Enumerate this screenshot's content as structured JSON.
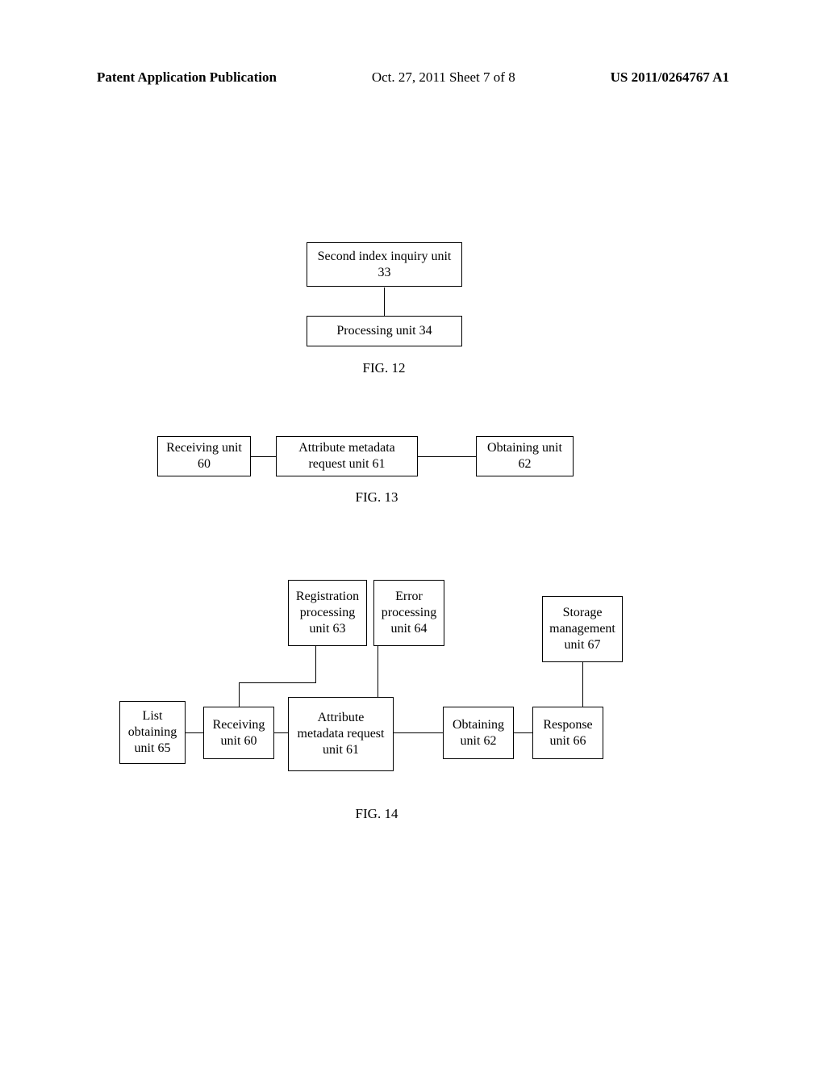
{
  "header": {
    "left": "Patent Application Publication",
    "center": "Oct. 27, 2011  Sheet 7 of 8",
    "right": "US 2011/0264767 A1"
  },
  "figures": {
    "fig12": {
      "caption": "FIG. 12",
      "boxes": {
        "second_index": "Second index inquiry unit 33",
        "processing": "Processing unit 34"
      }
    },
    "fig13": {
      "caption": "FIG. 13",
      "boxes": {
        "receiving": "Receiving unit 60",
        "attribute": "Attribute metadata request unit 61",
        "obtaining": "Obtaining unit 62"
      }
    },
    "fig14": {
      "caption": "FIG. 14",
      "boxes": {
        "registration": "Registration processing unit 63",
        "error": "Error processing unit 64",
        "storage": "Storage management unit 67",
        "list": "List obtaining unit 65",
        "receiving": "Receiving unit 60",
        "attribute": "Attribute metadata request unit 61",
        "obtaining": "Obtaining unit 62",
        "response": "Response unit 66"
      }
    }
  }
}
